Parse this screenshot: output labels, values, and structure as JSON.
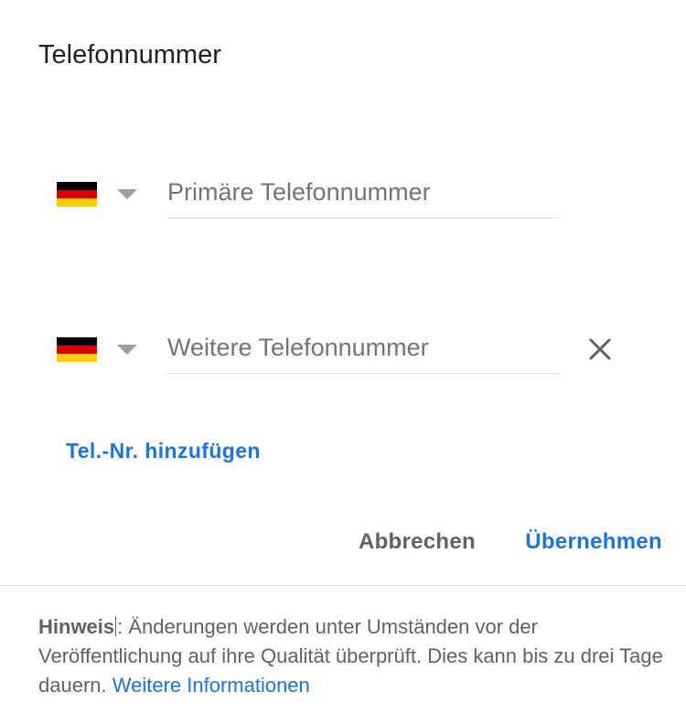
{
  "dialog": {
    "title": "Telefonnummer"
  },
  "phone_rows": [
    {
      "country": "Deutschland",
      "flag_icon": "germany-flag-icon",
      "flag_colors": [
        "#000000",
        "#dd0000",
        "#ffce00"
      ],
      "placeholder": "Primäre Telefonnummer",
      "value": ""
    },
    {
      "country": "Deutschland",
      "flag_icon": "germany-flag-icon",
      "flag_colors": [
        "#000000",
        "#dd0000",
        "#ffce00"
      ],
      "placeholder": "Weitere Telefonnummer",
      "value": "",
      "remove_icon": "close-icon"
    }
  ],
  "add_phone_label": "Tel.-Nr. hinzufügen",
  "actions": {
    "cancel_label": "Abbrechen",
    "apply_label": "Übernehmen"
  },
  "notice": {
    "bold": "Hinweis",
    "text": ": Änderungen werden unter Umständen vor der Veröffentlichung auf ihre Qualität überprüft. Dies kann bis zu drei Tage dauern. ",
    "link": "Weitere Informationen"
  },
  "colors": {
    "accent": "#1a73e8",
    "text_primary": "#202124",
    "text_secondary": "#5f6368",
    "placeholder": "#70757a",
    "divider": "#dadce0",
    "caret": "#9aa0a6"
  }
}
